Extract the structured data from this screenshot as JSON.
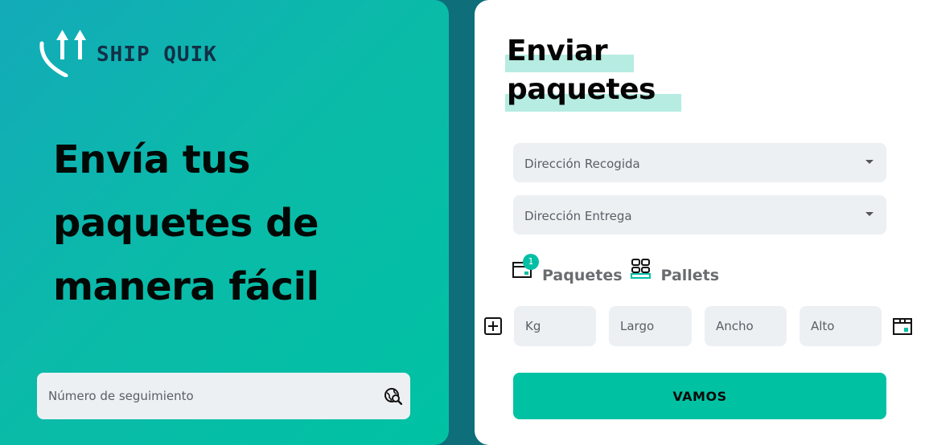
{
  "brand": {
    "name": "SHIP QUIK"
  },
  "hero": {
    "lines": [
      "Envía tus",
      "paquetes de",
      "manera fácil"
    ]
  },
  "tracking": {
    "placeholder": "Número de seguimiento",
    "icon": "search-globe-icon"
  },
  "form": {
    "title_lines": [
      "Enviar",
      "paquetes"
    ],
    "pickup_select": {
      "label": "Dirección Recogida"
    },
    "delivery_select": {
      "label": "Dirección Entrega"
    },
    "tabs": [
      {
        "label": "Paquetes",
        "icon": "package-icon",
        "badge": "1"
      },
      {
        "label": "Pallets",
        "icon": "pallet-icon"
      }
    ],
    "dimensions": {
      "kg": "Kg",
      "largo": "Largo",
      "ancho": "Ancho",
      "alto": "Alto"
    },
    "submit_label": "VAMOS"
  },
  "colors": {
    "accent": "#00c2a3",
    "highlight": "#b6ece2",
    "field_bg": "#edf0f3",
    "background": "#0e6e7a"
  }
}
